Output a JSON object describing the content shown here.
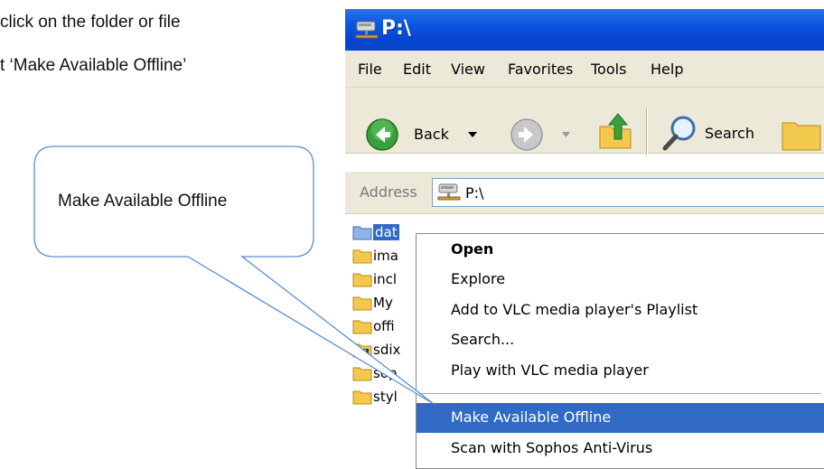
{
  "instructions": {
    "line1": " click on the folder or file",
    "line2": "t ‘Make Available Offline’"
  },
  "callout": {
    "text": "Make Available Offline"
  },
  "window": {
    "title": "P:\\",
    "menu": [
      "File",
      "Edit",
      "View",
      "Favorites",
      "Tools",
      "Help"
    ],
    "toolbar": {
      "back_label": "Back",
      "search_label": "Search"
    },
    "address": {
      "label": "Address",
      "value": "P:\\"
    },
    "files": [
      {
        "name": "dat",
        "icon": "folder-icon",
        "selected": true
      },
      {
        "name": "ima",
        "icon": "folder-icon"
      },
      {
        "name": "incl",
        "icon": "folder-icon"
      },
      {
        "name": "My",
        "icon": "folder-icon"
      },
      {
        "name": "offi",
        "icon": "folder-icon"
      },
      {
        "name": "sdix",
        "icon": "film-folder-icon"
      },
      {
        "name": "sop",
        "icon": "folder-icon"
      },
      {
        "name": "styl",
        "icon": "folder-icon"
      }
    ]
  },
  "context_menu": {
    "items": [
      {
        "label": "Open",
        "bold": true
      },
      {
        "label": "Explore"
      },
      {
        "label": "Add to VLC media player's Playlist"
      },
      {
        "label": "Search..."
      },
      {
        "label": "Play with VLC media player"
      },
      {
        "label": "Make Available Offline",
        "highlighted": true
      },
      {
        "label": "Scan with Sophos Anti-Virus"
      }
    ]
  },
  "colors": {
    "title_bar": "#0a58e2",
    "selection": "#316ac5",
    "chrome": "#ece9d8",
    "callout_border": "#5b8fd0"
  }
}
